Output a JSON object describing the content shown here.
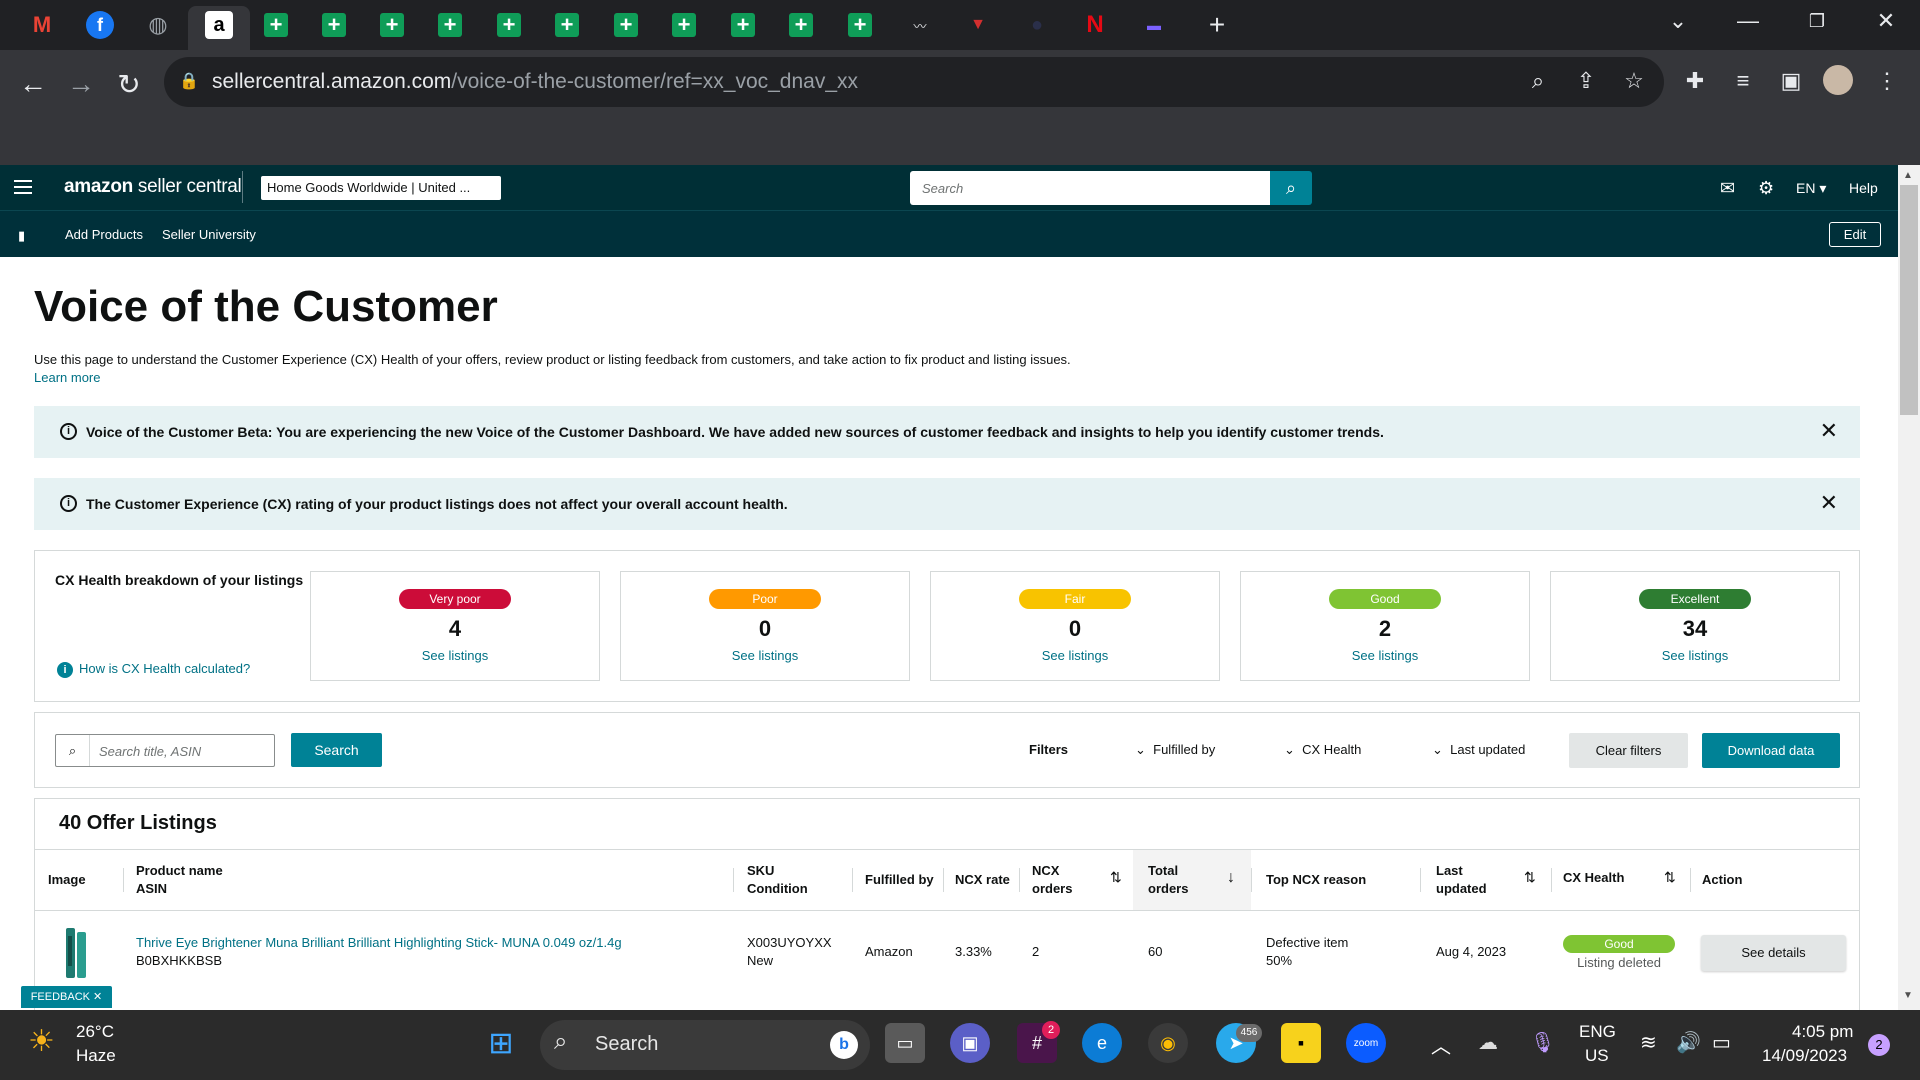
{
  "browser": {
    "url_host": "sellercentral.amazon.com",
    "url_path": "/voice-of-the-customer/ref=xx_voc_dnav_xx"
  },
  "header": {
    "logo_bold": "amazon",
    "logo_rest": " seller central",
    "store": "Home Goods Worldwide | United ...",
    "search_placeholder": "Search",
    "lang": "EN ▾",
    "help": "Help"
  },
  "subnav": {
    "items": [
      "Add Products",
      "Seller University"
    ],
    "edit": "Edit"
  },
  "page": {
    "title": "Voice of the Customer",
    "description": "Use this page to understand the Customer Experience (CX) Health of your offers, review product or listing feedback from customers, and take action to fix product and listing issues.",
    "learn_more": "Learn more"
  },
  "alerts": [
    "Voice of the Customer Beta: You are experiencing the new Voice of the Customer Dashboard. We have added new sources of customer feedback and insights to help you identify customer trends.",
    "The Customer Experience (CX) rating of your product listings does not affect your overall account health."
  ],
  "cx": {
    "title": "CX Health breakdown of your listings",
    "how": "How is CX Health calculated?",
    "cards": [
      {
        "label": "Very poor",
        "count": "4",
        "link": "See listings",
        "color": "#cc0c39"
      },
      {
        "label": "Poor",
        "count": "0",
        "link": "See listings",
        "color": "#ff9900"
      },
      {
        "label": "Fair",
        "count": "0",
        "link": "See listings",
        "color": "#f8c300"
      },
      {
        "label": "Good",
        "count": "2",
        "link": "See listings",
        "color": "#7fc433"
      },
      {
        "label": "Excellent",
        "count": "34",
        "link": "See listings",
        "color": "#2e7d32"
      }
    ]
  },
  "filters": {
    "search_placeholder": "Search title, ASIN",
    "search_btn": "Search",
    "label": "Filters",
    "fulfilled_by": "Fulfilled by",
    "cx_health": "CX Health",
    "last_updated": "Last updated",
    "clear": "Clear filters",
    "download": "Download data"
  },
  "listings": {
    "title": "40 Offer Listings",
    "columns": {
      "image": "Image",
      "product_name": "Product name",
      "asin": "ASIN",
      "sku": "SKU",
      "condition": "Condition",
      "fulfilled_by": "Fulfilled by",
      "ncx_rate": "NCX rate",
      "ncx_orders_1": "NCX",
      "ncx_orders_2": "orders",
      "total_orders_1": "Total",
      "total_orders_2": "orders",
      "top_reason": "Top NCX reason",
      "last_updated_1": "Last",
      "last_updated_2": "updated",
      "cx_health": "CX Health",
      "action": "Action"
    },
    "rows": [
      {
        "product_name": "Thrive Eye Brightener Muna Brilliant Brilliant Highlighting Stick- MUNA 0.049 oz/1.4g",
        "asin": "B0BXHKKBSB",
        "sku": "X003UYOYXX",
        "condition": "New",
        "fulfilled_by": "Amazon",
        "ncx_rate": "3.33%",
        "ncx_orders": "2",
        "total_orders": "60",
        "top_reason": "Defective item",
        "top_reason_pct": "50%",
        "last_updated": "Aug 4, 2023",
        "cx_health": "Good",
        "cx_status": "Listing deleted",
        "action": "See details"
      }
    ]
  },
  "feedback": "FEEDBACK ✕",
  "taskbar": {
    "weather_temp": "26°C",
    "weather_desc": "Haze",
    "search": "Search",
    "lang_1": "ENG",
    "lang_2": "US",
    "time": "4:05 pm",
    "date": "14/09/2023",
    "notif": "2",
    "slack_badge": "2",
    "telegram_badge": "456"
  }
}
